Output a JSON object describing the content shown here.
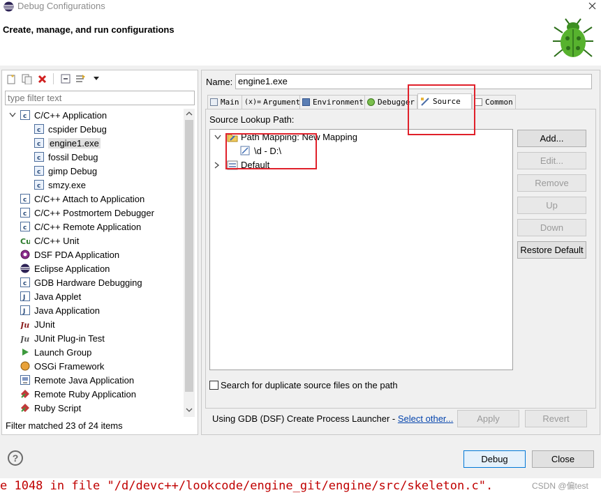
{
  "window": {
    "title": "Debug Configurations"
  },
  "header": {
    "title": "Create, manage, and run configurations"
  },
  "left": {
    "filter_placeholder": "type filter text",
    "tree": [
      {
        "label": "C/C++ Application",
        "kind": "category",
        "expanded": true,
        "icon": "c-category-icon"
      },
      {
        "label": "cspider Debug",
        "kind": "child",
        "icon": "c-file-icon"
      },
      {
        "label": "engine1.exe",
        "kind": "child",
        "selected": true,
        "icon": "c-file-icon"
      },
      {
        "label": "fossil Debug",
        "kind": "child",
        "icon": "c-file-icon"
      },
      {
        "label": "gimp Debug",
        "kind": "child",
        "icon": "c-file-icon"
      },
      {
        "label": "smzy.exe",
        "kind": "child",
        "icon": "c-file-icon"
      },
      {
        "label": "C/C++ Attach to Application",
        "kind": "category",
        "icon": "c-category-icon"
      },
      {
        "label": "C/C++ Postmortem Debugger",
        "kind": "category",
        "icon": "c-category-icon"
      },
      {
        "label": "C/C++ Remote Application",
        "kind": "category",
        "icon": "c-category-icon"
      },
      {
        "label": "C/C++ Unit",
        "kind": "category",
        "icon": "cu-icon"
      },
      {
        "label": "DSF PDA Application",
        "kind": "category",
        "icon": "pda-icon"
      },
      {
        "label": "Eclipse Application",
        "kind": "category",
        "icon": "eclipse-icon"
      },
      {
        "label": "GDB Hardware Debugging",
        "kind": "category",
        "icon": "c-category-icon"
      },
      {
        "label": "Java Applet",
        "kind": "category",
        "icon": "java-icon"
      },
      {
        "label": "Java Application",
        "kind": "category",
        "icon": "java-icon"
      },
      {
        "label": "JUnit",
        "kind": "category",
        "icon": "junit-icon"
      },
      {
        "label": "JUnit Plug-in Test",
        "kind": "category",
        "icon": "junit-plugin-icon"
      },
      {
        "label": "Launch Group",
        "kind": "category",
        "icon": "launch-group-icon"
      },
      {
        "label": "OSGi Framework",
        "kind": "category",
        "icon": "osgi-icon"
      },
      {
        "label": "Remote Java Application",
        "kind": "category",
        "icon": "remote-java-icon"
      },
      {
        "label": "Remote Ruby Application",
        "kind": "category",
        "icon": "ruby-icon"
      },
      {
        "label": "Ruby Script",
        "kind": "category",
        "icon": "ruby-icon"
      }
    ],
    "status": "Filter matched 23 of 24 items"
  },
  "right": {
    "name_label": "Name:",
    "name_value": "engine1.exe",
    "tabs": [
      "Main",
      "Arguments",
      "Environment",
      "Debugger",
      "Source",
      "Common"
    ],
    "active_tab": "Source",
    "source_lookup_label": "Source Lookup Path:",
    "source_tree": {
      "mapping": "Path Mapping: New Mapping",
      "mapping_child": "\\d - D:\\",
      "default": "Default"
    },
    "buttons": {
      "add": "Add...",
      "edit": "Edit...",
      "remove": "Remove",
      "up": "Up",
      "down": "Down",
      "restore": "Restore Default"
    },
    "search_dup_label": "Search for duplicate source files on the path",
    "launcher_text": "Using GDB (DSF) Create Process Launcher - ",
    "launcher_link": "Select other...",
    "apply": "Apply",
    "revert": "Revert"
  },
  "footer": {
    "debug": "Debug",
    "close": "Close"
  },
  "console": {
    "text": "e 1048 in file \"/d/devc++/lookcode/engine_git/engine/src/skeleton.c\"."
  },
  "watermark": "CSDN @偏test",
  "colors": {
    "highlight_box": "#e0202a",
    "link": "#0645ad",
    "console_text": "#c00000"
  }
}
